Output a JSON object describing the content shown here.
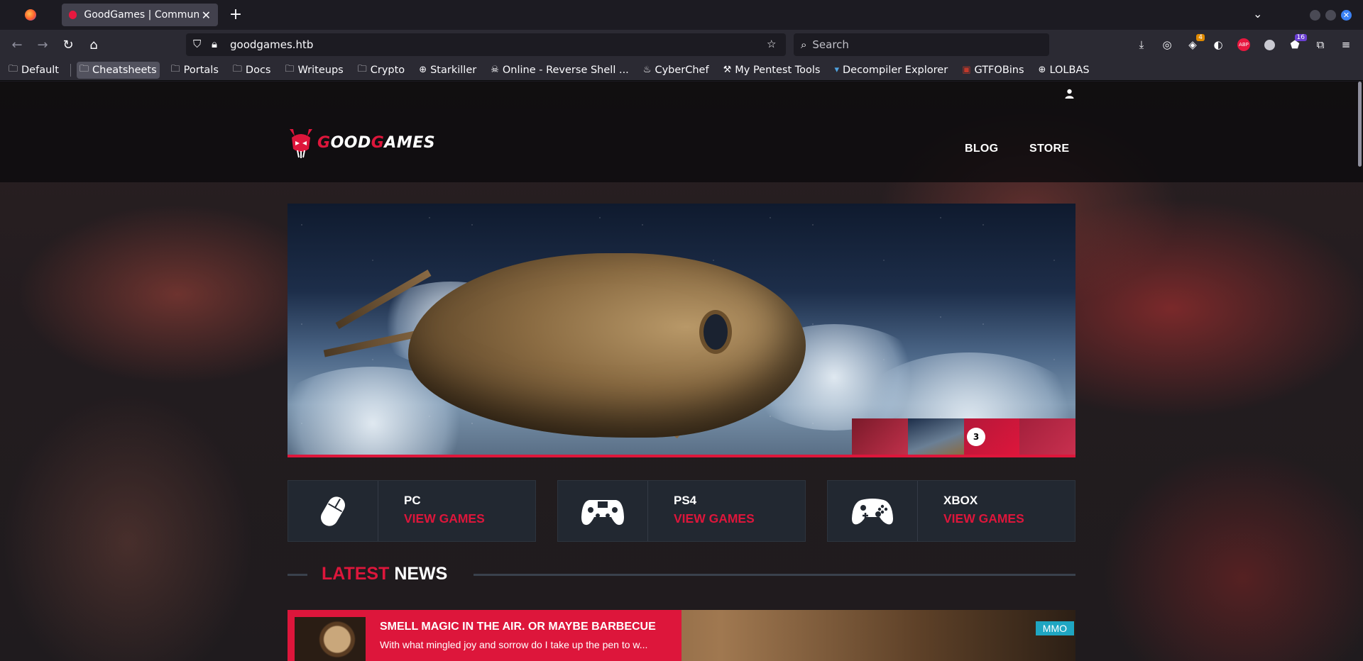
{
  "browser": {
    "tab_title": "GoodGames | Community",
    "url": "goodgames.htb",
    "search_placeholder": "Search",
    "extension_badges": {
      "first": "4",
      "second": "16"
    },
    "bookmarks": [
      {
        "label": "Default",
        "icon": "folder-icon"
      },
      {
        "label": "Cheatsheets",
        "icon": "folder-icon"
      },
      {
        "label": "Portals",
        "icon": "folder-icon"
      },
      {
        "label": "Docs",
        "icon": "folder-icon"
      },
      {
        "label": "Writeups",
        "icon": "folder-icon"
      },
      {
        "label": "Crypto",
        "icon": "folder-icon"
      },
      {
        "label": "Starkiller",
        "icon": "globe-icon"
      },
      {
        "label": "Online - Reverse Shell ...",
        "icon": "skull-icon"
      },
      {
        "label": "CyberChef",
        "icon": "chef-icon"
      },
      {
        "label": "My Pentest Tools",
        "icon": "tools-icon"
      },
      {
        "label": "Decompiler Explorer",
        "icon": "decompiler-icon"
      },
      {
        "label": "GTFOBins",
        "icon": "gtfobins-icon"
      },
      {
        "label": "LOLBAS",
        "icon": "globe-icon"
      }
    ]
  },
  "site": {
    "logo": {
      "part1_red": "G",
      "part1": "OOD",
      "part2_red": "G",
      "part2": "AMES"
    },
    "menu": {
      "blog": "BLOG",
      "store": "STORE"
    },
    "hero": {
      "active_slide": "3"
    },
    "platforms": [
      {
        "name": "PC",
        "link": "VIEW GAMES",
        "icon": "mouse-icon"
      },
      {
        "name": "PS4",
        "link": "VIEW GAMES",
        "icon": "ps4-controller-icon"
      },
      {
        "name": "XBOX",
        "link": "VIEW GAMES",
        "icon": "xbox-controller-icon"
      }
    ],
    "news_heading": {
      "red": "LATEST",
      "white": "NEWS"
    },
    "news": [
      {
        "title": "SMELL MAGIC IN THE AIR. OR MAYBE BARBECUE",
        "excerpt": "With what mingled joy and sorrow do I take up the pen to w...",
        "tag": "MMO"
      }
    ]
  },
  "colors": {
    "accent": "#dd163b",
    "tag": "#1fa6c2",
    "card": "#222831"
  }
}
